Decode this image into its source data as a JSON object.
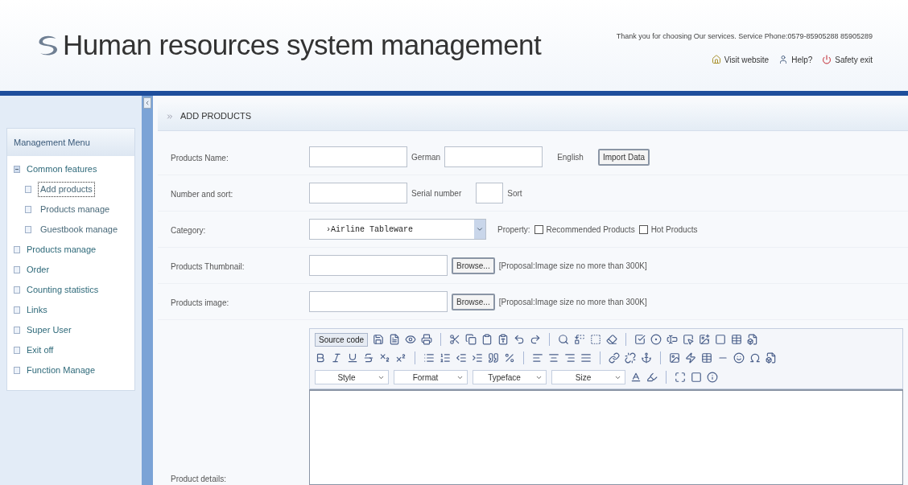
{
  "header": {
    "title": "Human resources system management",
    "notice": "Thank you for choosing Our services.  Service Phone:0579-85905288  85905289",
    "links": [
      {
        "kind": "home",
        "label": "Visit website"
      },
      {
        "kind": "user",
        "label": "Help?"
      },
      {
        "kind": "exit",
        "label": "Safety exit"
      }
    ]
  },
  "sidebar": {
    "title": "Management Menu",
    "items": [
      {
        "label": "Common features",
        "expanded": true,
        "children": [
          {
            "label": "Add products",
            "selected": true
          },
          {
            "label": "Products manage",
            "selected": false
          },
          {
            "label": "Guestbook manage",
            "selected": false
          }
        ]
      },
      {
        "label": "Products manage",
        "expanded": false
      },
      {
        "label": "Order",
        "expanded": false
      },
      {
        "label": "Counting statistics",
        "expanded": false
      },
      {
        "label": "Links",
        "expanded": false
      },
      {
        "label": "Super User",
        "expanded": false
      },
      {
        "label": "Exit off",
        "expanded": false
      },
      {
        "label": "Function Manage",
        "expanded": false
      }
    ]
  },
  "panel": {
    "title": "ADD PRODUCTS",
    "form": [
      {
        "kind": "name",
        "label": "Products Name:",
        "field_1_label": "German",
        "field_2_label": "English",
        "button": "Import Data"
      },
      {
        "kind": "number",
        "label": "Number and sort:",
        "field_1_label": "Serial number",
        "field_2_label": "Sort"
      },
      {
        "kind": "category",
        "label": "Category:",
        "value": "›Airline Tableware",
        "property_label": "Property:",
        "options": [
          {
            "label": "Recommended Products",
            "checked": false
          },
          {
            "label": "Hot Products",
            "checked": false
          }
        ]
      },
      {
        "kind": "file",
        "label": "Products Thumbnail:",
        "button": "Browse...",
        "hint": "[Proposal:Image size no more than 300K]"
      },
      {
        "kind": "file",
        "label": "Products image:",
        "button": "Browse...",
        "hint": "[Proposal:Image size no more than 300K]"
      },
      {
        "kind": "editor",
        "label": "Product details:",
        "source_button": "Source code",
        "dropdowns": [
          "Style",
          "Format",
          "Typeface",
          "Size"
        ]
      }
    ]
  }
}
